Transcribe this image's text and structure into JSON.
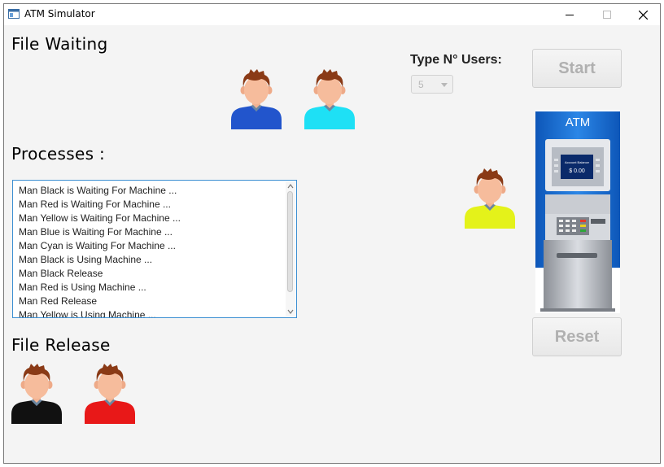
{
  "window": {
    "title": "ATM Simulator"
  },
  "labels": {
    "file_waiting": "File Waiting",
    "processes": "Processes :",
    "file_release": "File Release",
    "type_users": "Type N° Users:"
  },
  "controls": {
    "users_select_value": "5",
    "start_label": "Start",
    "reset_label": "Reset"
  },
  "log": [
    "Man Black is Waiting For Machine ...",
    "Man Red is Waiting For Machine ...",
    "Man Yellow is Waiting For Machine ...",
    "Man Blue is Waiting For Machine ...",
    "Man Cyan is Waiting For Machine ...",
    "Man Black is Using Machine ...",
    "Man Black Release",
    "Man Red is Using Machine ...",
    "Man Red Release",
    "Man Yellow is Using Machine ..."
  ],
  "atm": {
    "sign": "ATM",
    "screen_line1": "Account Balance",
    "screen_line2": "$ 0.00"
  },
  "people": {
    "waiting": [
      {
        "color": "blue",
        "shirt": "#2255cc"
      },
      {
        "color": "cyan",
        "shirt": "#1ee0f5"
      }
    ],
    "at_machine": {
      "color": "yellow",
      "shirt": "#e4f21a"
    },
    "released": [
      {
        "color": "black",
        "shirt": "#111111"
      },
      {
        "color": "red",
        "shirt": "#e81818"
      }
    ]
  }
}
